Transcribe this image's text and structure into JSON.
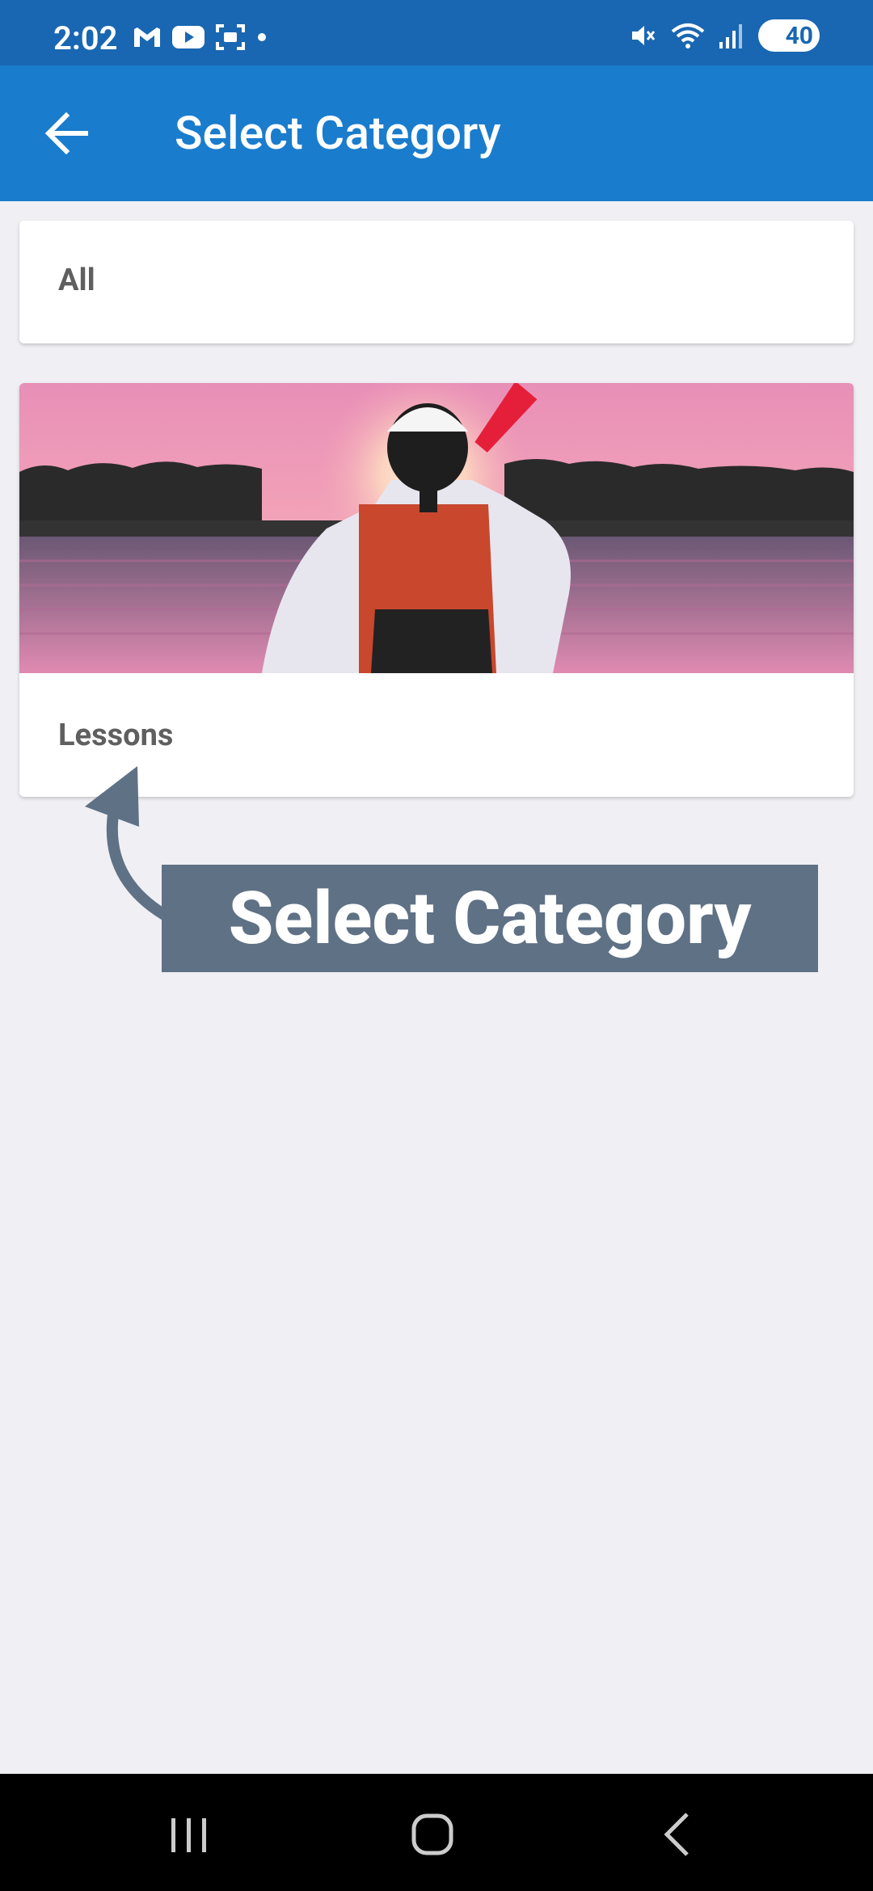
{
  "status_bar": {
    "time": "2:02",
    "battery": "40",
    "left_icons": [
      "gmail-icon",
      "youtube-icon",
      "screenshot-icon",
      "dot-icon"
    ],
    "right_icons": [
      "mute-icon",
      "wifi-icon",
      "signal-icon",
      "battery-icon"
    ]
  },
  "app_bar": {
    "title": "Select Category",
    "back_icon": "arrow-left-icon"
  },
  "categories": [
    {
      "label": "All"
    },
    {
      "label": "Lessons",
      "image": "kayak-sunset-photo"
    }
  ],
  "annotation": {
    "text": "Select Category",
    "background_color": "#5f7185"
  },
  "nav_bar": {
    "buttons": [
      "recent-apps-icon",
      "home-icon",
      "back-icon"
    ]
  },
  "colors": {
    "status_bar": "#1967b2",
    "app_bar": "#1a7ccd",
    "background": "#efeff4",
    "label_text": "#5f5f5f"
  }
}
